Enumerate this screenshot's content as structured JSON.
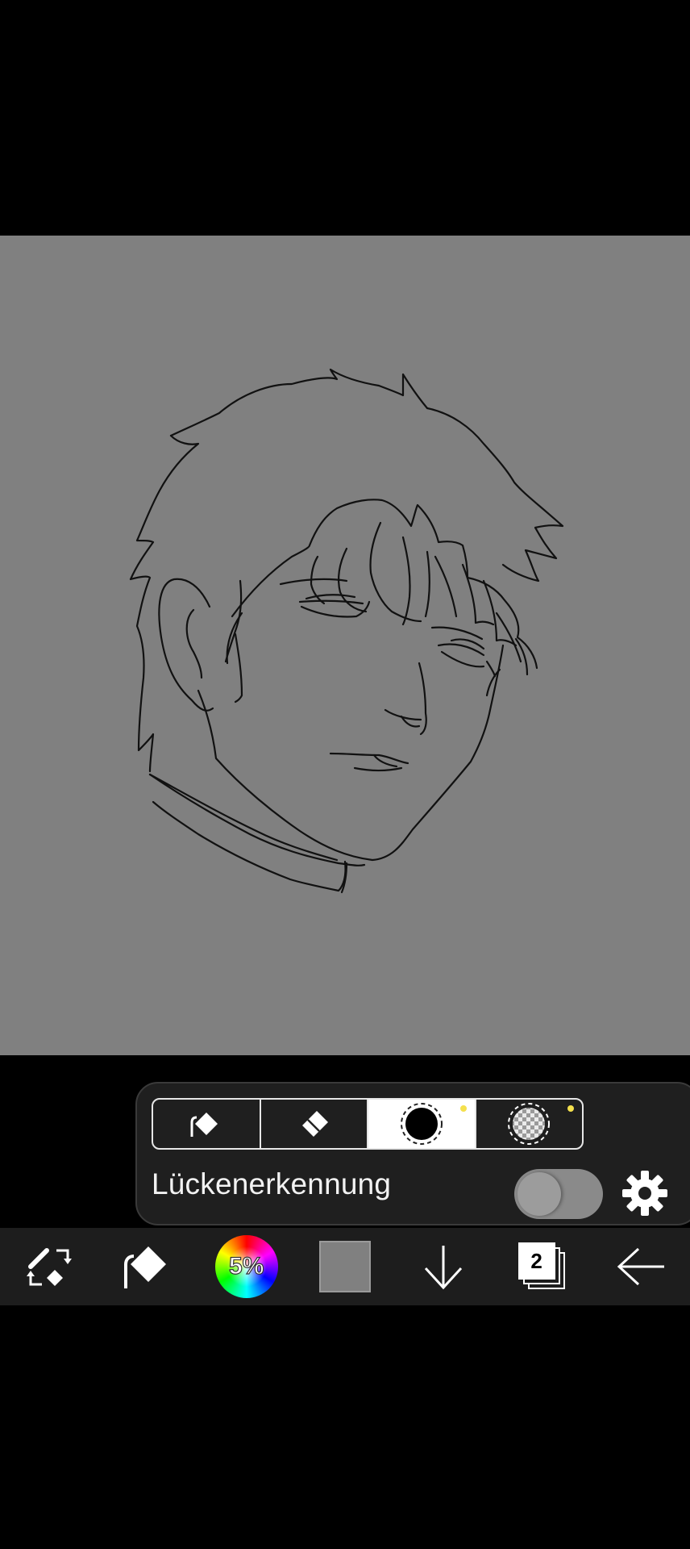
{
  "canvas": {
    "background": "#808080",
    "content": "line-art sketch of a face"
  },
  "fill_panel": {
    "modes": [
      {
        "icon": "bucket-fill-icon",
        "active": false
      },
      {
        "icon": "eraser-icon",
        "active": false
      },
      {
        "icon": "black-color-fill-icon",
        "active": true,
        "dot_color": "#f4e04d"
      },
      {
        "icon": "transparent-fill-icon",
        "active": false,
        "dot_color": "#f4e04d"
      }
    ],
    "gap_detection_label": "Lückenerkennung",
    "gap_detection_enabled": false
  },
  "toolbar": {
    "tools": [
      "swap-tool-icon",
      "bucket-fill-icon",
      "color-wheel",
      "color-swatch",
      "down-arrow-icon",
      "layers-icon",
      "back-arrow-icon"
    ],
    "opacity_label": "5%",
    "current_color": "#808080",
    "layer_count": "2"
  },
  "colors": {
    "panel_bg": "#1f1f1f",
    "toolbar_bg": "#1d1d1d",
    "accent_dot": "#f4e04d"
  }
}
